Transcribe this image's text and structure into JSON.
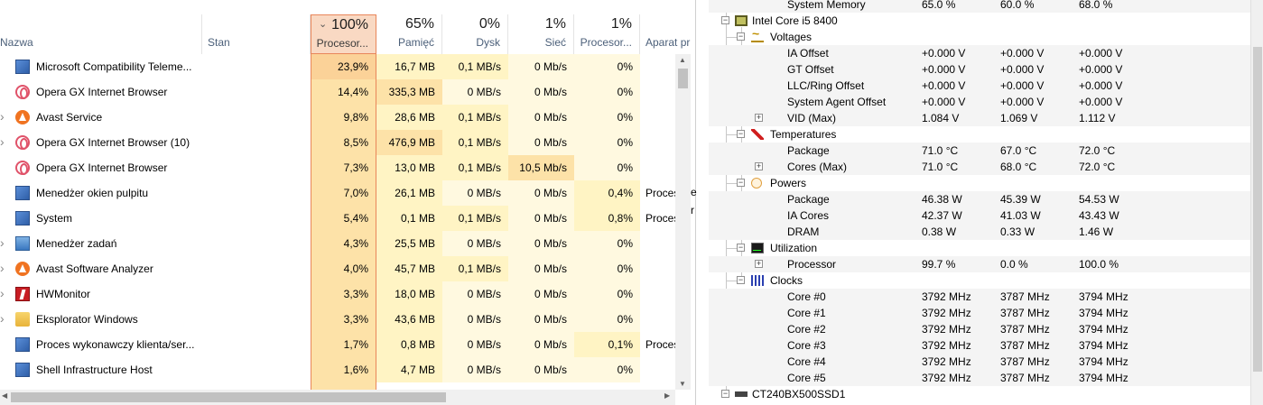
{
  "task_manager": {
    "columns": [
      {
        "key": "name",
        "label": "Nazwa",
        "pct": ""
      },
      {
        "key": "status",
        "label": "Stan",
        "pct": ""
      },
      {
        "key": "cpu",
        "label": "Procesor...",
        "pct": "100%",
        "sorted": true
      },
      {
        "key": "mem",
        "label": "Pamięć",
        "pct": "65%"
      },
      {
        "key": "disk",
        "label": "Dysk",
        "pct": "0%"
      },
      {
        "key": "net",
        "label": "Sieć",
        "pct": "1%"
      },
      {
        "key": "gpu",
        "label": "Procesor...",
        "pct": "1%"
      },
      {
        "key": "engine",
        "label": "Aparat pr",
        "pct": ""
      }
    ],
    "rows": [
      {
        "name": "Microsoft Compatibility Teleme...",
        "icon": "app-window-icon",
        "expandable": false,
        "cpu": "23,9%",
        "mem": "16,7 MB",
        "disk": "0,1 MB/s",
        "net": "0 Mb/s",
        "gpu": "0%",
        "engine": ""
      },
      {
        "name": "Opera GX Internet Browser",
        "icon": "opera-gx-icon",
        "expandable": false,
        "cpu": "14,4%",
        "mem": "335,3 MB",
        "disk": "0 MB/s",
        "net": "0 Mb/s",
        "gpu": "0%",
        "engine": ""
      },
      {
        "name": "Avast Service",
        "icon": "avast-icon",
        "expandable": true,
        "cpu": "9,8%",
        "mem": "28,6 MB",
        "disk": "0,1 MB/s",
        "net": "0 Mb/s",
        "gpu": "0%",
        "engine": ""
      },
      {
        "name": "Opera GX Internet Browser (10)",
        "icon": "opera-gx-icon",
        "expandable": true,
        "cpu": "8,5%",
        "mem": "476,9 MB",
        "disk": "0,1 MB/s",
        "net": "0 Mb/s",
        "gpu": "0%",
        "engine": ""
      },
      {
        "name": "Opera GX Internet Browser",
        "icon": "opera-gx-icon",
        "expandable": false,
        "cpu": "7,3%",
        "mem": "13,0 MB",
        "disk": "0,1 MB/s",
        "net": "10,5 Mb/s",
        "gpu": "0%",
        "engine": ""
      },
      {
        "name": "Menedżer okien pulpitu",
        "icon": "app-window-icon",
        "expandable": false,
        "cpu": "7,0%",
        "mem": "26,1 MB",
        "disk": "0 MB/s",
        "net": "0 Mb/s",
        "gpu": "0,4%",
        "engine": "Proces"
      },
      {
        "name": "System",
        "icon": "app-window-icon",
        "expandable": false,
        "cpu": "5,4%",
        "mem": "0,1 MB",
        "disk": "0,1 MB/s",
        "net": "0 Mb/s",
        "gpu": "0,8%",
        "engine": "Proces"
      },
      {
        "name": "Menedżer zadań",
        "icon": "task-manager-icon",
        "expandable": true,
        "cpu": "4,3%",
        "mem": "25,5 MB",
        "disk": "0 MB/s",
        "net": "0 Mb/s",
        "gpu": "0%",
        "engine": ""
      },
      {
        "name": "Avast Software Analyzer",
        "icon": "avast-icon",
        "expandable": true,
        "cpu": "4,0%",
        "mem": "45,7 MB",
        "disk": "0,1 MB/s",
        "net": "0 Mb/s",
        "gpu": "0%",
        "engine": ""
      },
      {
        "name": "HWMonitor",
        "icon": "hwmonitor-icon",
        "expandable": true,
        "cpu": "3,3%",
        "mem": "18,0 MB",
        "disk": "0 MB/s",
        "net": "0 Mb/s",
        "gpu": "0%",
        "engine": ""
      },
      {
        "name": "Eksplorator Windows",
        "icon": "folder-icon",
        "expandable": true,
        "cpu": "3,3%",
        "mem": "43,6 MB",
        "disk": "0 MB/s",
        "net": "0 Mb/s",
        "gpu": "0%",
        "engine": ""
      },
      {
        "name": "Proces wykonawczy klienta/ser...",
        "icon": "app-window-icon",
        "expandable": false,
        "cpu": "1,7%",
        "mem": "0,8 MB",
        "disk": "0 MB/s",
        "net": "0 Mb/s",
        "gpu": "0,1%",
        "engine": "Proces"
      },
      {
        "name": "Shell Infrastructure Host",
        "icon": "app-window-icon",
        "expandable": false,
        "cpu": "1,6%",
        "mem": "4,7 MB",
        "disk": "0 MB/s",
        "net": "0 Mb/s",
        "gpu": "0%",
        "engine": ""
      }
    ]
  },
  "gap_fragments": [
    "e",
    "r"
  ],
  "hwmonitor": {
    "rows": [
      {
        "label": "System Memory",
        "v1": "65.0 %",
        "v2": "60.0 %",
        "v3": "68.0 %",
        "level": 3,
        "kind": "leaf"
      },
      {
        "label": "Intel Core i5 8400",
        "level": 0,
        "kind": "device",
        "icon": "cpu-chip-icon"
      },
      {
        "label": "Voltages",
        "level": 1,
        "kind": "group",
        "icon": "voltage-icon"
      },
      {
        "label": "IA Offset",
        "v1": "+0.000 V",
        "v2": "+0.000 V",
        "v3": "+0.000 V",
        "level": 2,
        "kind": "leaf"
      },
      {
        "label": "GT Offset",
        "v1": "+0.000 V",
        "v2": "+0.000 V",
        "v3": "+0.000 V",
        "level": 2,
        "kind": "leaf"
      },
      {
        "label": "LLC/Ring Offset",
        "v1": "+0.000 V",
        "v2": "+0.000 V",
        "v3": "+0.000 V",
        "level": 2,
        "kind": "leaf"
      },
      {
        "label": "System Agent Offset",
        "v1": "+0.000 V",
        "v2": "+0.000 V",
        "v3": "+0.000 V",
        "level": 2,
        "kind": "leaf"
      },
      {
        "label": "VID (Max)",
        "v1": "1.084 V",
        "v2": "1.069 V",
        "v3": "1.112 V",
        "level": 2,
        "kind": "expandable"
      },
      {
        "label": "Temperatures",
        "level": 1,
        "kind": "group",
        "icon": "thermometer-icon"
      },
      {
        "label": "Package",
        "v1": "71.0 °C",
        "v2": "67.0 °C",
        "v3": "72.0 °C",
        "level": 2,
        "kind": "leaf"
      },
      {
        "label": "Cores (Max)",
        "v1": "71.0 °C",
        "v2": "68.0 °C",
        "v3": "72.0 °C",
        "level": 2,
        "kind": "expandable"
      },
      {
        "label": "Powers",
        "level": 1,
        "kind": "group",
        "icon": "power-icon"
      },
      {
        "label": "Package",
        "v1": "46.38 W",
        "v2": "45.39 W",
        "v3": "54.53 W",
        "level": 2,
        "kind": "leaf"
      },
      {
        "label": "IA Cores",
        "v1": "42.37 W",
        "v2": "41.03 W",
        "v3": "43.43 W",
        "level": 2,
        "kind": "leaf"
      },
      {
        "label": "DRAM",
        "v1": "0.38 W",
        "v2": "0.33 W",
        "v3": "1.46 W",
        "level": 2,
        "kind": "leaf"
      },
      {
        "label": "Utilization",
        "level": 1,
        "kind": "group",
        "icon": "utilization-icon"
      },
      {
        "label": "Processor",
        "v1": "99.7 %",
        "v2": "0.0 %",
        "v3": "100.0 %",
        "level": 2,
        "kind": "expandable"
      },
      {
        "label": "Clocks",
        "level": 1,
        "kind": "group",
        "icon": "clock-icon"
      },
      {
        "label": "Core #0",
        "v1": "3792 MHz",
        "v2": "3787 MHz",
        "v3": "3794 MHz",
        "level": 2,
        "kind": "leaf"
      },
      {
        "label": "Core #1",
        "v1": "3792 MHz",
        "v2": "3787 MHz",
        "v3": "3794 MHz",
        "level": 2,
        "kind": "leaf"
      },
      {
        "label": "Core #2",
        "v1": "3792 MHz",
        "v2": "3787 MHz",
        "v3": "3794 MHz",
        "level": 2,
        "kind": "leaf"
      },
      {
        "label": "Core #3",
        "v1": "3792 MHz",
        "v2": "3787 MHz",
        "v3": "3794 MHz",
        "level": 2,
        "kind": "leaf"
      },
      {
        "label": "Core #4",
        "v1": "3792 MHz",
        "v2": "3787 MHz",
        "v3": "3794 MHz",
        "level": 2,
        "kind": "leaf"
      },
      {
        "label": "Core #5",
        "v1": "3792 MHz",
        "v2": "3787 MHz",
        "v3": "3794 MHz",
        "level": 2,
        "kind": "leaf"
      },
      {
        "label": "CT240BX500SSD1",
        "level": 0,
        "kind": "device",
        "icon": "drive-icon"
      }
    ]
  },
  "colors": {
    "cpu_header_bg": "#f9d9c3",
    "cpu_header_border": "#e8865a",
    "heat_high": "#fbd298",
    "heat_mid": "#fde2a8",
    "heat_low": "#fff4c4",
    "heat_none": "#fff9e0"
  }
}
